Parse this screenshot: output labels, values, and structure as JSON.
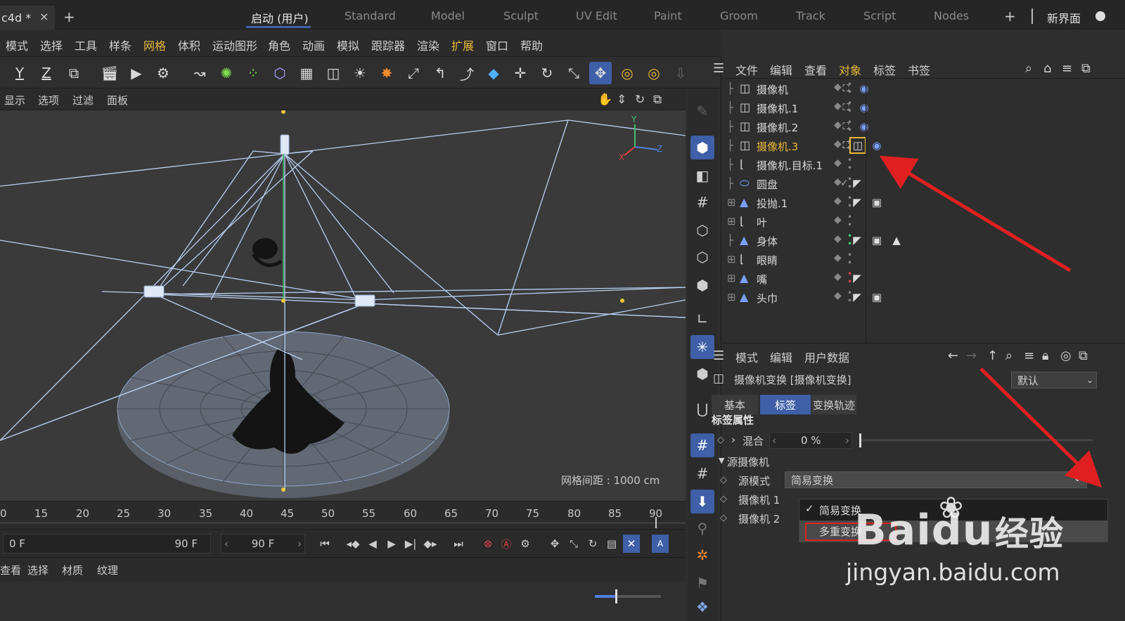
{
  "titlebar": {
    "doc_tab": "c4d *",
    "close": "×",
    "new_tab": "+",
    "workspaces": [
      "启动 (用户)",
      "Standard",
      "Model",
      "Sculpt",
      "UV Edit",
      "Paint",
      "Groom",
      "Track",
      "Script",
      "Nodes"
    ],
    "active_workspace": "启动 (用户)",
    "add_layout": "+",
    "new_ui": "新界面"
  },
  "menubar": [
    "模式",
    "选择",
    "工具",
    "样条",
    "网格",
    "体积",
    "运动图形",
    "角色",
    "动画",
    "模拟",
    "跟踪器",
    "渲染",
    "扩展",
    "窗口",
    "帮助"
  ],
  "menubar_highlight": [
    "网格",
    "扩展"
  ],
  "toolbar": {
    "axis_y": "Y",
    "axis_z": "Z"
  },
  "viewport": {
    "menu": [
      "显示",
      "选项",
      "过滤",
      "面板"
    ],
    "grid_spacing": "网格间距 : 1000 cm",
    "axis_labels": {
      "x": "X",
      "y": "Y",
      "z": "Z"
    }
  },
  "timeline": {
    "ticks": [
      "0",
      "15",
      "20",
      "25",
      "30",
      "35",
      "40",
      "45",
      "50",
      "55",
      "60",
      "65",
      "70",
      "75",
      "80",
      "85",
      "90"
    ],
    "start_frame": "0 F",
    "end_frame": "90 F",
    "current_frame": "90 F"
  },
  "material_bar": [
    "查看",
    "选择",
    "材质",
    "纹理"
  ],
  "object_manager": {
    "menu": [
      "文件",
      "编辑",
      "查看",
      "对象",
      "标签",
      "书签"
    ],
    "menu_highlight": "对象",
    "objects": [
      {
        "name": "摄像机",
        "selected": false
      },
      {
        "name": "摄像机.1",
        "selected": false
      },
      {
        "name": "摄像机.2",
        "selected": false
      },
      {
        "name": "摄像机.3",
        "selected": true
      },
      {
        "name": "摄像机.目标.1",
        "selected": false
      },
      {
        "name": "圆盘",
        "selected": false
      },
      {
        "name": "投抛.1",
        "selected": false
      },
      {
        "name": "叶",
        "selected": false
      },
      {
        "name": "身体",
        "selected": false
      },
      {
        "name": "眼睛",
        "selected": false
      },
      {
        "name": "嘴",
        "selected": false
      },
      {
        "name": "头巾",
        "selected": false
      }
    ]
  },
  "attribute_manager": {
    "menu": [
      "模式",
      "编辑",
      "用户数据"
    ],
    "title": "摄像机变换 [摄像机变换]",
    "preset": "默认",
    "tabs": [
      "基本",
      "标签",
      "变换轨迹"
    ],
    "active_tab": "标签",
    "section": "标签属性",
    "blend_label": "混合",
    "blend_value": "0 %",
    "blend_fraction": 0.0,
    "group": "源摄像机",
    "source_mode_label": "源模式",
    "source_mode_value": "简易变换",
    "camera1_label": "摄像机 1",
    "camera2_label": "摄像机 2",
    "dropdown_options": [
      "简易变换",
      "多重变换"
    ],
    "dropdown_checked": "简易变换",
    "dropdown_hover": "多重变换"
  },
  "watermark": {
    "brand": "Baidu",
    "suffix": "经验",
    "url": "jingyan.baidu.com"
  },
  "colors": {
    "accent_blue": "#3f5fa8",
    "highlight_yellow": "#e9b938",
    "annotation_red": "#e02020"
  }
}
